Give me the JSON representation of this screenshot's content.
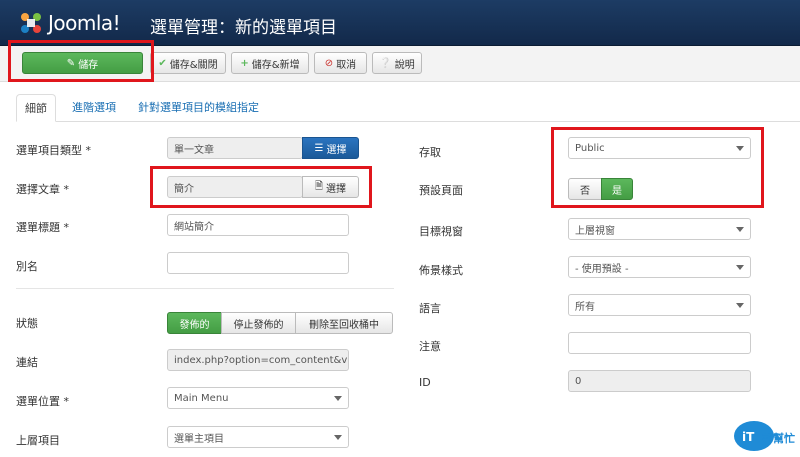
{
  "header": {
    "logo_text": "Joomla!",
    "title": "選單管理：新的選單項目"
  },
  "toolbar": {
    "save": "儲存",
    "save_close": "儲存&關閉",
    "save_new": "儲存&新增",
    "cancel": "取消",
    "help": "說明"
  },
  "tabs": [
    "細節",
    "進階選項",
    "針對選單項目的模組指定"
  ],
  "left": {
    "menu_item_type": {
      "label": "選單項目類型 *",
      "value": "單一文章",
      "button": "選擇"
    },
    "select_article": {
      "label": "選擇文章 *",
      "value": "簡介",
      "button": "選擇"
    },
    "menu_title": {
      "label": "選單標題 *",
      "value": "網站簡介"
    },
    "alias": {
      "label": "別名",
      "value": ""
    },
    "status": {
      "label": "狀態",
      "options": [
        "發佈的",
        "停止發佈的",
        "刪除至回收桶中"
      ],
      "selected": "發佈的"
    },
    "link": {
      "label": "連結",
      "value": "index.php?option=com_content&vie"
    },
    "menu_location": {
      "label": "選單位置 *",
      "value": "Main Menu"
    },
    "parent_item": {
      "label": "上層項目",
      "value": "選單主項目"
    }
  },
  "right": {
    "access": {
      "label": "存取",
      "value": "Public"
    },
    "default_page": {
      "label": "預設頁面",
      "no": "否",
      "yes": "是",
      "selected": "是"
    },
    "target_window": {
      "label": "目標視窗",
      "value": "上層視窗"
    },
    "template_style": {
      "label": "佈景樣式",
      "value": "- 使用預設 -"
    },
    "language": {
      "label": "語言",
      "value": "所有"
    },
    "note": {
      "label": "注意",
      "value": ""
    },
    "id": {
      "label": "ID",
      "value": "0"
    }
  },
  "watermark": {
    "text": "iT邦幫忙"
  },
  "colors": {
    "accent_green": "#5cb85c",
    "accent_blue": "#2b74c0",
    "highlight_red": "#e0161c",
    "header_bg": "#1d3c64"
  }
}
